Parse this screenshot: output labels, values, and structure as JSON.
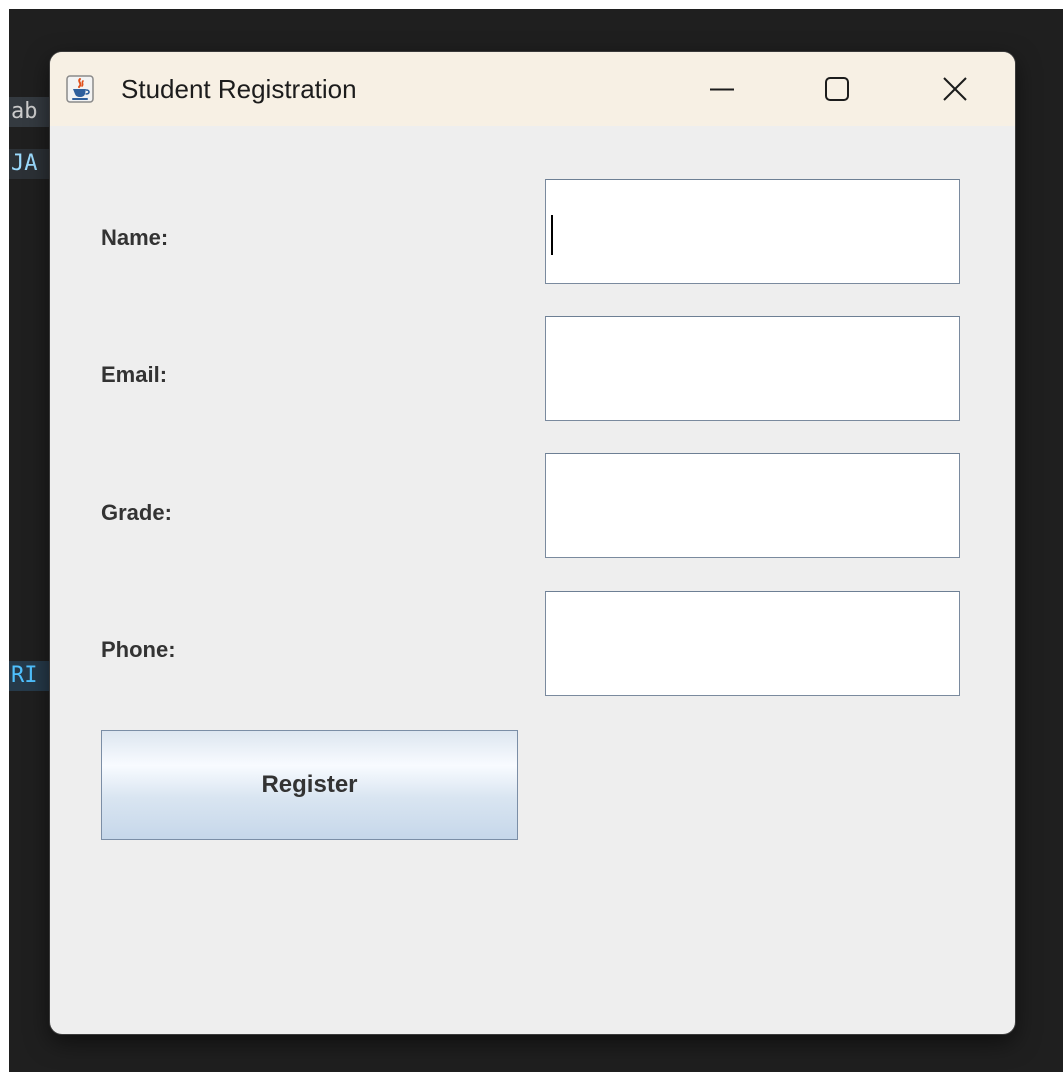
{
  "window": {
    "title": "Student Registration",
    "icon": "java-cup-icon",
    "controls": {
      "minimize_icon": "minimize-icon",
      "maximize_icon": "maximize-icon",
      "close_icon": "close-icon"
    }
  },
  "background_editor": {
    "fragments": [
      "ab",
      "JA",
      "RI"
    ]
  },
  "form": {
    "fields": [
      {
        "label": "Name:",
        "value": "",
        "focused": true
      },
      {
        "label": "Email:",
        "value": ""
      },
      {
        "label": "Grade:",
        "value": ""
      },
      {
        "label": "Phone:",
        "value": ""
      }
    ],
    "register_label": "Register"
  },
  "colors": {
    "desktop_background": "#1f1f1f",
    "window_background": "#eeeeee",
    "titlebar_background": "#f7f0e4",
    "label_text": "#333333",
    "button_gradient_bottom": "#c6d7ea"
  }
}
